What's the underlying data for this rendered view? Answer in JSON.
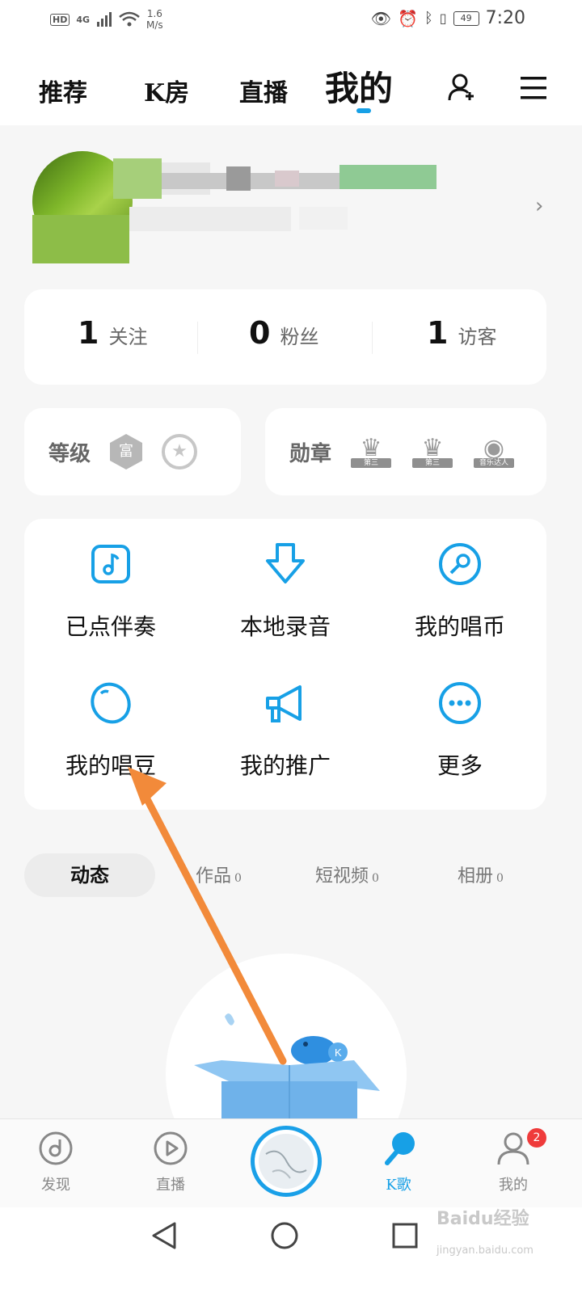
{
  "status_bar": {
    "left": {
      "hd": "HD",
      "network": "4G",
      "speed_value": "1.6",
      "speed_unit": "M/s"
    },
    "battery": "49",
    "time": "7:20"
  },
  "top_tabs": [
    {
      "label": "推荐"
    },
    {
      "label": "K房"
    },
    {
      "label": "直播"
    },
    {
      "label": "我的",
      "active": true
    }
  ],
  "stats": [
    {
      "value": "1",
      "label": "关注"
    },
    {
      "value": "0",
      "label": "粉丝"
    },
    {
      "value": "1",
      "label": "访客"
    }
  ],
  "level": {
    "label": "等级",
    "badge_text": "富"
  },
  "medals": {
    "label": "勋章",
    "ribbons": [
      "第三",
      "第三",
      "音乐达人"
    ]
  },
  "grid": [
    {
      "label": "已点伴奏",
      "icon": "music-note-icon"
    },
    {
      "label": "本地录音",
      "icon": "download-icon"
    },
    {
      "label": "我的唱币",
      "icon": "coin-icon"
    },
    {
      "label": "我的唱豆",
      "icon": "bean-icon"
    },
    {
      "label": "我的推广",
      "icon": "megaphone-icon"
    },
    {
      "label": "更多",
      "icon": "more-icon"
    }
  ],
  "sub_tabs": [
    {
      "label": "动态",
      "active": true
    },
    {
      "label": "作品",
      "count": "0"
    },
    {
      "label": "短视频",
      "count": "0"
    },
    {
      "label": "相册",
      "count": "0"
    }
  ],
  "bottom_nav": [
    {
      "label": "发现",
      "icon": "disc-icon"
    },
    {
      "label": "直播",
      "icon": "play-icon"
    },
    {
      "label": "K歌",
      "icon": "microphone-icon",
      "active": true
    },
    {
      "label": "我的",
      "icon": "user-icon",
      "badge": "2"
    }
  ],
  "watermark": {
    "brand": "Baidu经验",
    "url": "jingyan.baidu.com"
  },
  "colors": {
    "accent": "#17a0e6",
    "annotation_arrow": "#f28a3a",
    "badge_red": "#ef3b3b"
  }
}
